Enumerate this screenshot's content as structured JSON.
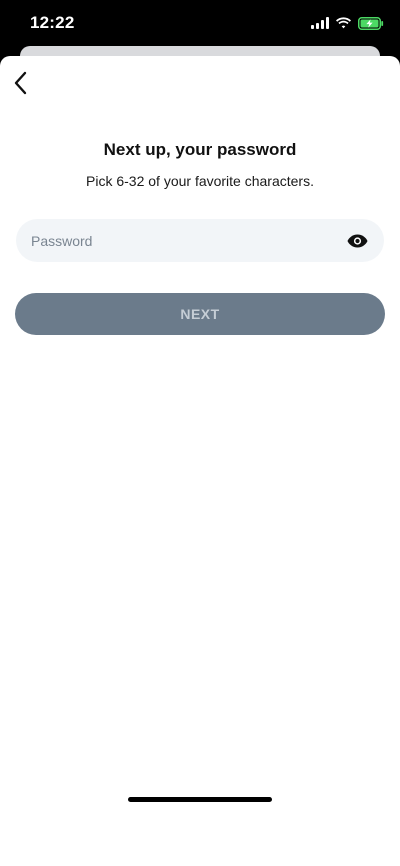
{
  "status_bar": {
    "time": "12:22",
    "battery_color": "#4cd964"
  },
  "nav": {
    "back_icon": "chevron-left-icon"
  },
  "header": {
    "title": "Next up, your password",
    "subtitle": "Pick 6-32 of your favorite characters."
  },
  "password": {
    "value": "",
    "placeholder": "Password",
    "toggle_icon": "eye-icon"
  },
  "actions": {
    "next_label": "NEXT",
    "next_color": "#6b7b8b"
  }
}
